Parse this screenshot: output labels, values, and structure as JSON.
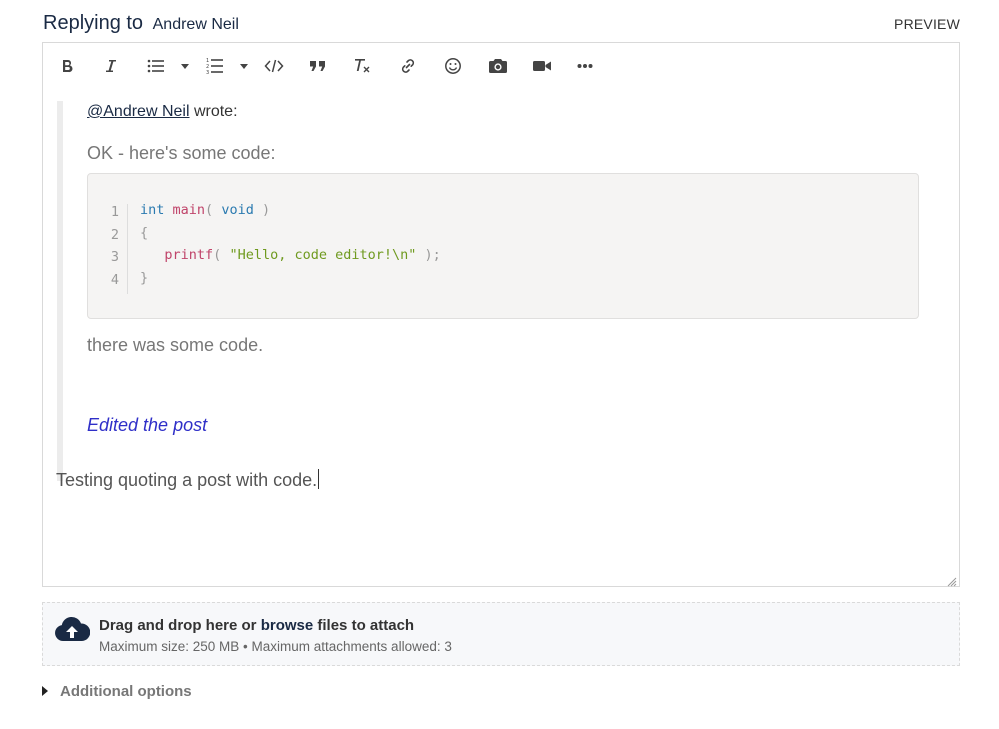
{
  "header": {
    "prefix": "Replying to",
    "recipient": "Andrew Neil",
    "preview_label": "PREVIEW"
  },
  "toolbar": {
    "buttons": [
      {
        "icon": "bold-icon",
        "title": "Bold"
      },
      {
        "icon": "italic-icon",
        "title": "Italic"
      },
      {
        "icon": "bulleted-list-icon",
        "title": "Bulleted List"
      },
      {
        "icon": "numbered-list-icon",
        "title": "Numbered List"
      },
      {
        "icon": "code-icon",
        "title": "Code"
      },
      {
        "icon": "quote-icon",
        "title": "Block Quote"
      },
      {
        "icon": "remove-format-icon",
        "title": "Remove Format"
      },
      {
        "icon": "link-icon",
        "title": "Link"
      },
      {
        "icon": "emoji-icon",
        "title": "Emoji"
      },
      {
        "icon": "camera-icon",
        "title": "Insert Image"
      },
      {
        "icon": "video-icon",
        "title": "Insert Video"
      },
      {
        "icon": "more-icon",
        "title": "More"
      }
    ]
  },
  "quote": {
    "author_link": "@Andrew Neil",
    "author_suffix": "wrote:",
    "intro": "OK - here's some code:",
    "code": {
      "line_numbers": [
        "1",
        "2",
        "3",
        "4"
      ],
      "lines": [
        [
          {
            "t": "int",
            "c": "kw"
          },
          {
            "t": " ",
            "c": "pn"
          },
          {
            "t": "main",
            "c": "fn"
          },
          {
            "t": "( ",
            "c": "pn"
          },
          {
            "t": "void",
            "c": "kw"
          },
          {
            "t": " )",
            "c": "pn"
          }
        ],
        [
          {
            "t": "{",
            "c": "pn"
          }
        ],
        [
          {
            "t": "   ",
            "c": "pn"
          },
          {
            "t": "printf",
            "c": "fn"
          },
          {
            "t": "( ",
            "c": "pn"
          },
          {
            "t": "\"Hello, code editor!\\n\"",
            "c": "str"
          },
          {
            "t": " );",
            "c": "pn"
          }
        ],
        [
          {
            "t": "}",
            "c": "pn"
          }
        ]
      ]
    },
    "after_code": "there was some code.",
    "edit_note": "Edited the post"
  },
  "body_text": "Testing quoting a post with code.",
  "attach": {
    "title_pre": "Drag and drop here or ",
    "title_link": "browse",
    "title_post": " files to attach",
    "meta": "Maximum size: 250 MB • Maximum attachments allowed: 3"
  },
  "additional_options": "Additional options",
  "colors": {
    "accent": "#1a2a44",
    "edit_note": "#2f2fc8",
    "quote_border": "#ececec"
  }
}
